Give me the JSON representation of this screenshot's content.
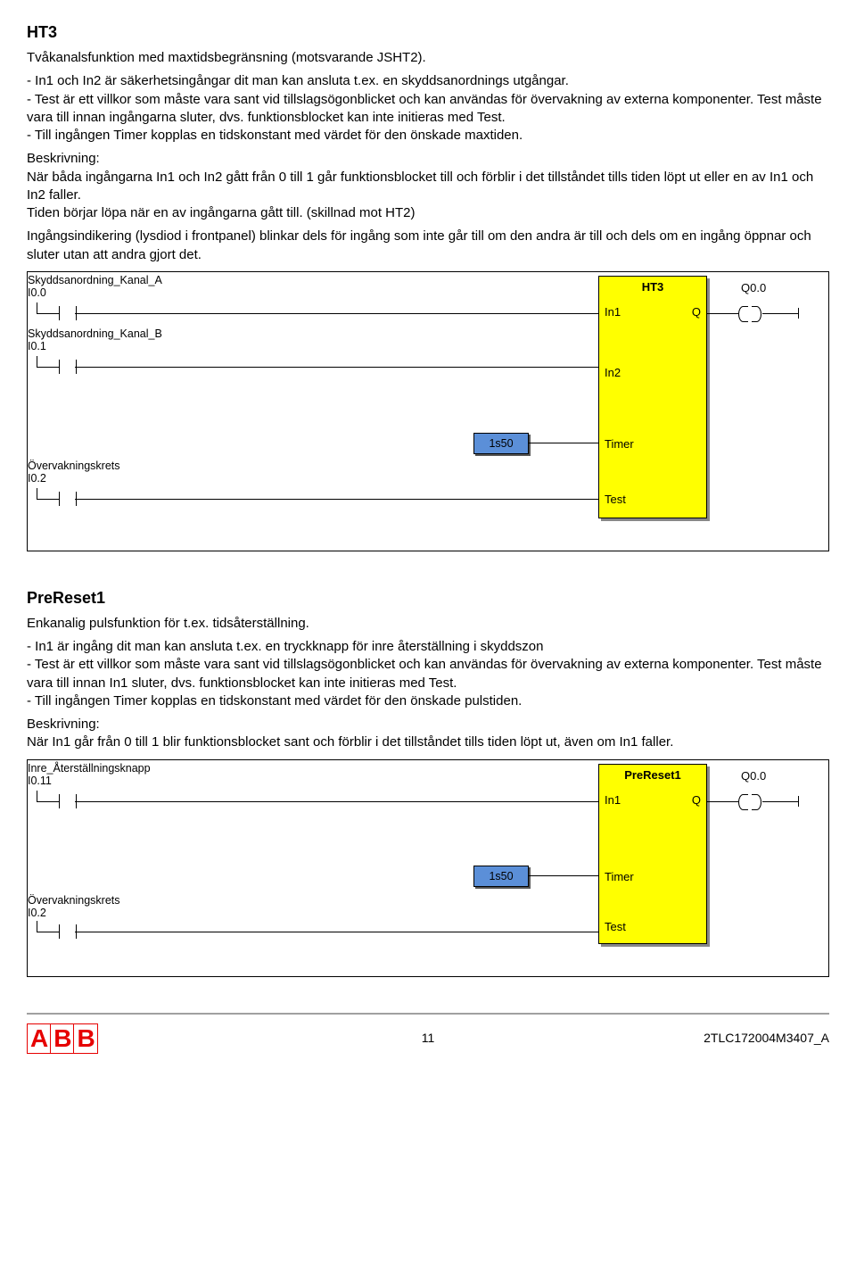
{
  "sections": {
    "ht3": {
      "title": "HT3",
      "intro": "Tvåkanalsfunktion med maxtidsbegränsning (motsvarande JSHT2).",
      "bullets": "- In1 och In2 är säkerhetsingångar dit man kan ansluta t.ex. en skyddsanordnings utgångar.\n- Test är ett villkor som måste vara sant vid tillslagsögonblicket och kan användas för övervakning av externa komponenter. Test måste vara till innan ingångarna sluter, dvs. funktionsblocket kan inte initieras med Test.\n- Till ingången Timer kopplas en tidskonstant med värdet för den önskade maxtiden.",
      "desc": "Beskrivning:\nNär båda ingångarna In1 och In2 gått från 0 till 1 går funktionsblocket till och förblir i det tillståndet tills tiden löpt ut eller en av In1 och In2 faller.\nTiden börjar löpa när en av ingångarna gått till. (skillnad mot HT2)",
      "desc2": "Ingångsindikering (lysdiod i frontpanel) blinkar dels för ingång som inte går till om den andra är till och dels om en ingång öppnar och sluter utan att andra gjort det."
    },
    "prereset": {
      "title": "PreReset1",
      "intro": "Enkanalig pulsfunktion för t.ex. tidsåterställning.",
      "bullets": "- In1 är ingång dit man kan ansluta t.ex. en tryckknapp för inre återställning i skyddszon\n- Test är ett villkor som måste vara sant vid tillslagsögonblicket och kan användas för övervakning av externa komponenter. Test måste vara till innan In1 sluter, dvs. funktionsblocket kan inte initieras med Test.\n- Till ingången Timer kopplas en tidskonstant med värdet för den önskade pulstiden.",
      "desc": "Beskrivning:\nNär In1 går från 0 till 1 blir funktionsblocket sant och förblir i det tillståndet tills tiden löpt ut, även om In1 faller."
    }
  },
  "diagram_ht3": {
    "inputs": [
      {
        "label": "Skyddsanordning_Kanal_A",
        "addr": "I0.0"
      },
      {
        "label": "Skyddsanordning_Kanal_B",
        "addr": "I0.1"
      },
      {
        "label": "Övervakningskrets",
        "addr": "I0.2"
      }
    ],
    "block_title": "HT3",
    "ports": {
      "in1": "In1",
      "in2": "In2",
      "timer": "Timer",
      "test": "Test",
      "q": "Q"
    },
    "timer_value": "1s50",
    "output_label": "Q0.0"
  },
  "diagram_prereset": {
    "inputs": [
      {
        "label": "Inre_Återställningsknapp",
        "addr": "I0.11"
      },
      {
        "label": "Övervakningskrets",
        "addr": "I0.2"
      }
    ],
    "block_title": "PreReset1",
    "ports": {
      "in1": "In1",
      "timer": "Timer",
      "test": "Test",
      "q": "Q"
    },
    "timer_value": "1s50",
    "output_label": "Q0.0"
  },
  "footer": {
    "logo": "ABB",
    "page": "11",
    "docid": "2TLC172004M3407_A"
  }
}
